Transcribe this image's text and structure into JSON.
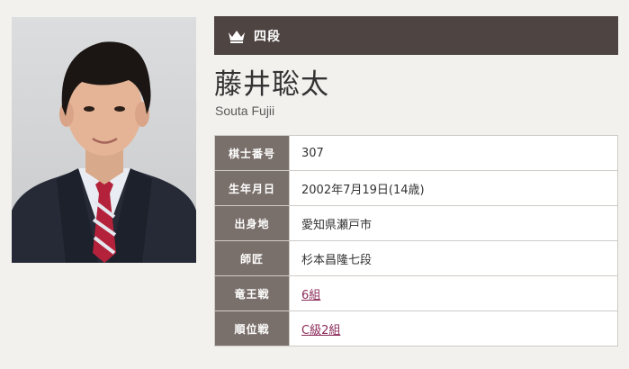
{
  "profile": {
    "rank": "四段",
    "name_jp": "藤井聡太",
    "name_en": "Souta Fujii",
    "photo_icon": "person-portrait-icon",
    "rank_icon": "crown-icon"
  },
  "info_rows": [
    {
      "label": "棋士番号",
      "value": "307",
      "link": false
    },
    {
      "label": "生年月日",
      "value": "2002年7月19日(14歳)",
      "link": false
    },
    {
      "label": "出身地",
      "value": "愛知県瀬戸市",
      "link": false
    },
    {
      "label": "師匠",
      "value": "杉本昌隆七段",
      "link": false
    },
    {
      "label": "竜王戦",
      "value": "6組",
      "link": true
    },
    {
      "label": "順位戦",
      "value": "C級2組",
      "link": true
    }
  ],
  "colors": {
    "header_bar": "#4e4441",
    "label_cell": "#7a706b",
    "link": "#8a2a58",
    "background": "#f3f1ee"
  }
}
